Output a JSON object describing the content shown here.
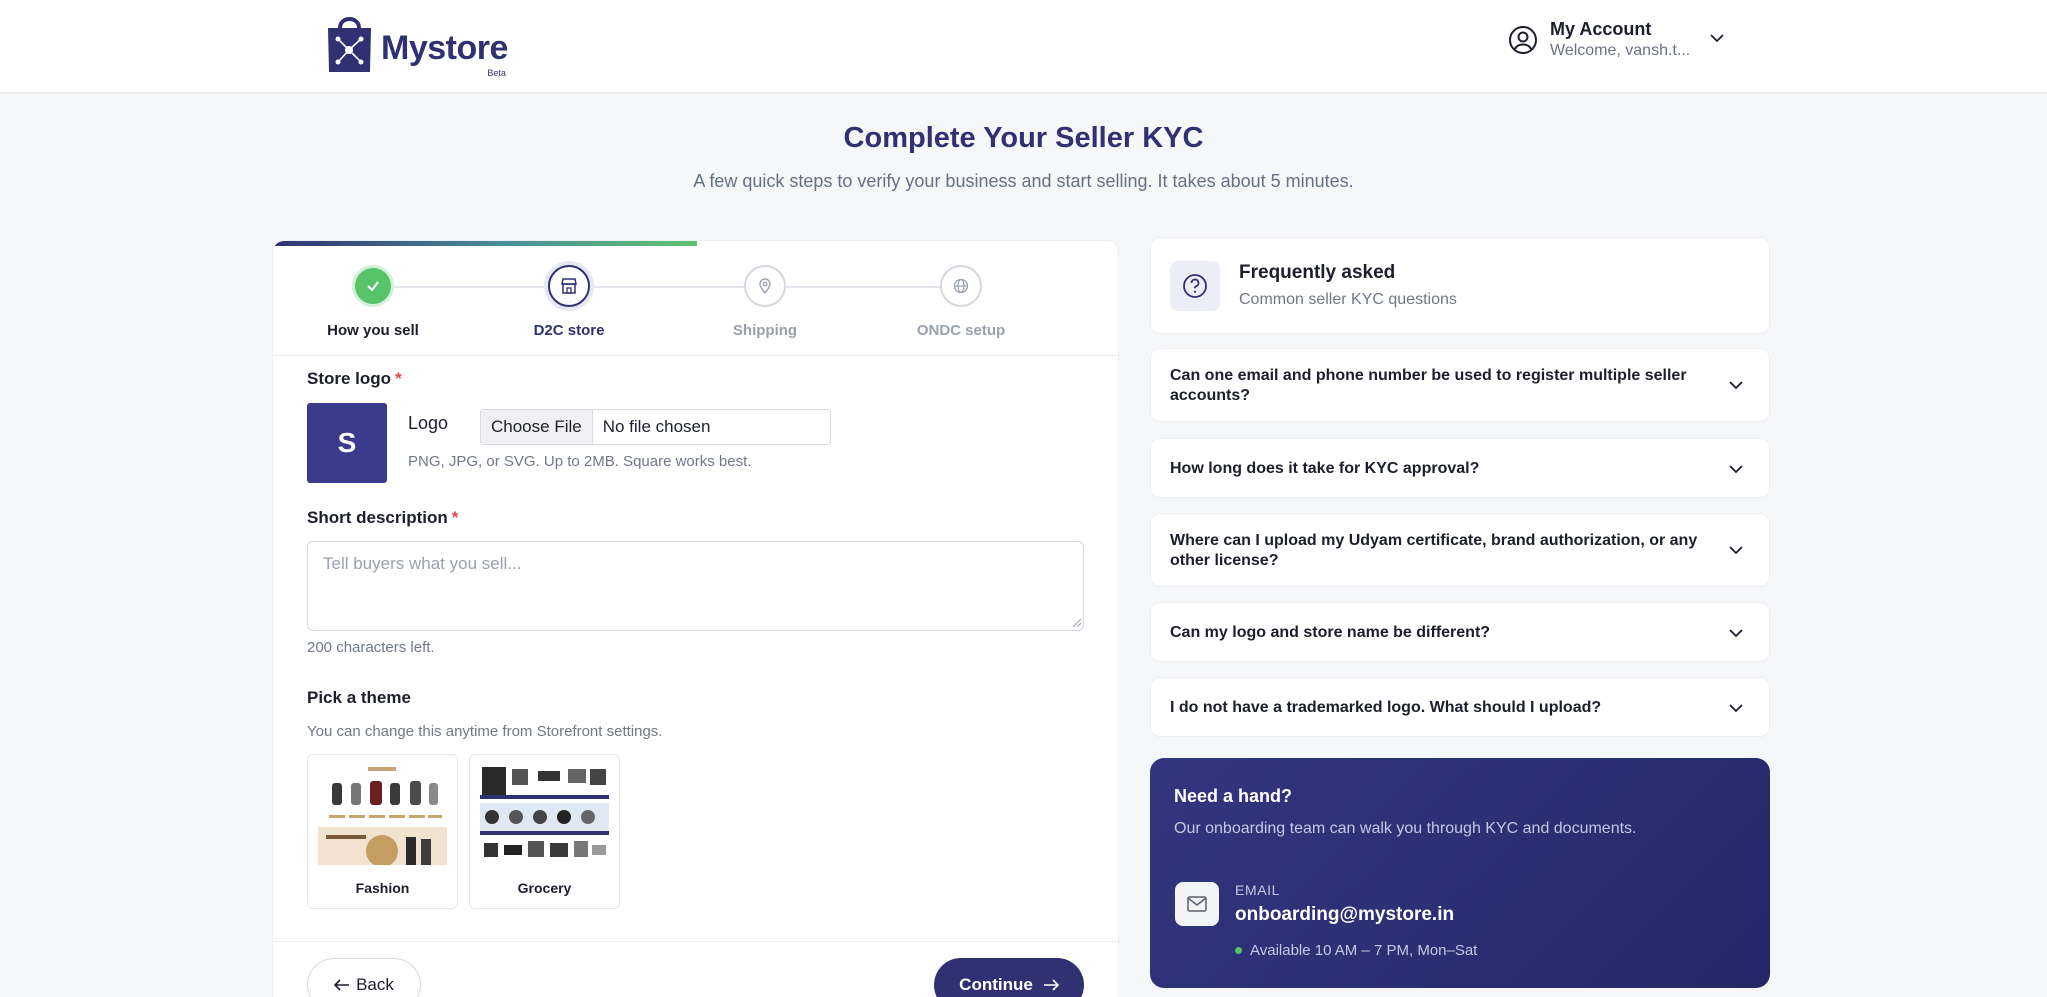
{
  "header": {
    "brand_name": "Mystore",
    "brand_badge": "Beta",
    "account_title": "My Account",
    "account_sub": "Welcome, vansh.t..."
  },
  "page": {
    "title": "Complete Your Seller KYC",
    "subtitle": "A few quick steps to verify your business and start selling. It takes about 5 minutes."
  },
  "stepper": {
    "progress_percent": 50,
    "steps": [
      {
        "label": "How you sell",
        "state": "done",
        "icon": "check-icon"
      },
      {
        "label": "D2C store",
        "state": "active",
        "icon": "store-icon"
      },
      {
        "label": "Shipping",
        "state": "pending",
        "icon": "location-pin-icon"
      },
      {
        "label": "ONDC setup",
        "state": "pending",
        "icon": "globe-icon"
      }
    ]
  },
  "form": {
    "store_logo_label": "Store logo",
    "required_mark": "*",
    "logo_initial": "S",
    "logo_field_name": "Logo",
    "file_button": "Choose File",
    "file_status": "No file chosen",
    "logo_hint": "PNG, JPG, or SVG. Up to 2MB. Square works best.",
    "description_label": "Short description",
    "description_placeholder": "Tell buyers what you sell...",
    "description_value": "",
    "chars_left": "200 characters left.",
    "theme_label": "Pick a theme",
    "theme_hint": "You can change this anytime from Storefront settings.",
    "themes": [
      {
        "name": "Fashion"
      },
      {
        "name": "Grocery"
      }
    ],
    "back_label": "Back",
    "continue_label": "Continue"
  },
  "faq": {
    "title": "Frequently asked",
    "subtitle": "Common seller KYC questions",
    "items": [
      {
        "q": "Can one email and phone number be used to register multiple seller accounts?"
      },
      {
        "q": "How long does it take for KYC approval?"
      },
      {
        "q": "Where can I upload my Udyam certificate, brand authorization, or any other license?"
      },
      {
        "q": "Can my logo and store name be different?"
      },
      {
        "q": "I do not have a trademarked logo. What should I upload?"
      }
    ]
  },
  "help": {
    "title": "Need a hand?",
    "subtitle": "Our onboarding team can walk you through KYC and documents.",
    "email_label": "EMAIL",
    "email": "onboarding@mystore.in",
    "availability": "Available 10 AM – 7 PM, Mon–Sat"
  },
  "colors": {
    "brand": "#2f3172",
    "success": "#58c46a",
    "required": "#e5484d"
  }
}
